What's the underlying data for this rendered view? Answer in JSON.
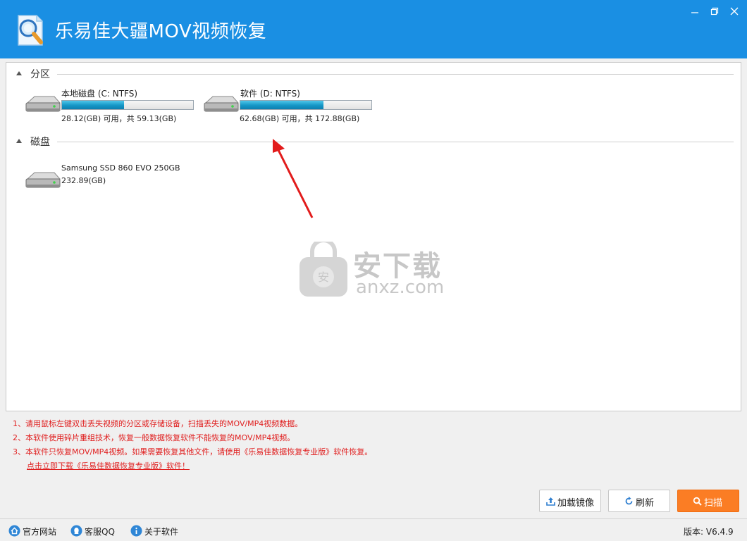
{
  "window": {
    "title": "乐易佳大疆MOV视频恢复",
    "controls": [
      "minimize",
      "maximize",
      "close"
    ]
  },
  "partitions": {
    "heading": "分区",
    "items": [
      {
        "name": "本地磁盘 (C: NTFS)",
        "free_fraction": 0.475,
        "size_text": "28.12(GB) 可用，共 59.13(GB)"
      },
      {
        "name": "软件 (D: NTFS)",
        "free_fraction": 0.636,
        "size_text": "62.68(GB) 可用，共 172.88(GB)"
      }
    ]
  },
  "disks": {
    "heading": "磁盘",
    "items": [
      {
        "name": "Samsung SSD 860 EVO 250GB",
        "size_text": "232.89(GB)"
      }
    ]
  },
  "watermark": {
    "brand": "安下载",
    "domain": "anxz.com"
  },
  "tips": {
    "line1": "1、请用鼠标左键双击丢失视频的分区或存储设备，扫描丢失的MOV/MP4视频数据。",
    "line2": "2、本软件使用碎片重组技术，恢复一般数据恢复软件不能恢复的MOV/MP4视频。",
    "line3": "3、本软件只恢复MOV/MP4视频。如果需要恢复其他文件，请使用《乐易佳数据恢复专业版》软件恢复。",
    "download_link": "点击立即下载《乐易佳数据恢复专业版》软件！"
  },
  "buttons": {
    "load_image": "加载镜像",
    "refresh": "刷新",
    "scan": "扫描"
  },
  "statusbar": {
    "website": "官方网站",
    "support": "客服QQ",
    "about": "关于软件",
    "version": "版本: V6.4.9"
  },
  "colors": {
    "titlebar": "#1a8fe3",
    "bar_fill": "#1596c6",
    "tip_text": "#e02020",
    "scan_button": "#fb7d24"
  }
}
